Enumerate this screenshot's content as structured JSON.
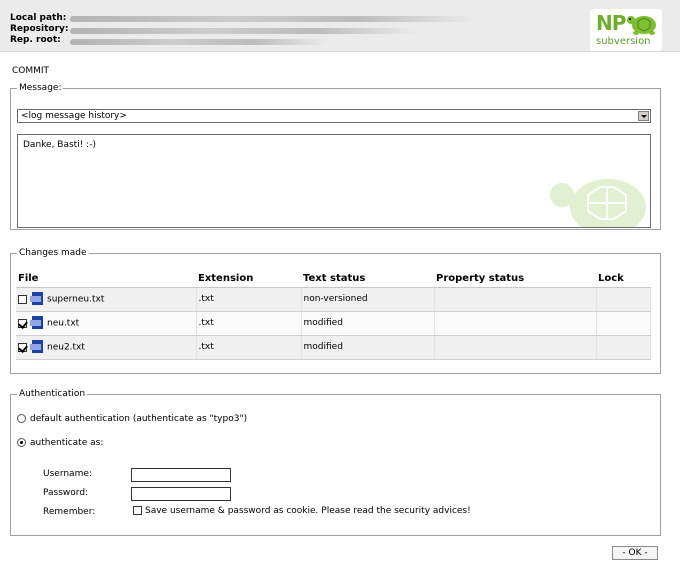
{
  "header": {
    "labels": [
      "Local path:",
      "Repository:",
      "Rep. root:"
    ],
    "logo": {
      "np": "NP",
      "sub": "subversion"
    }
  },
  "commit": {
    "title": "COMMIT",
    "message_legend": "Message:",
    "history_select": "<log message history>",
    "message_text": "Danke, Basti! :-)"
  },
  "changes": {
    "legend": "Changes made",
    "columns": [
      "File",
      "Extension",
      "Text status",
      "Property status",
      "Lock"
    ],
    "rows": [
      {
        "checked": false,
        "file": "superneu.txt",
        "ext": ".txt",
        "text_status": "non-versioned",
        "prop_status": "",
        "lock": ""
      },
      {
        "checked": true,
        "file": "neu.txt",
        "ext": ".txt",
        "text_status": "modified",
        "prop_status": "",
        "lock": ""
      },
      {
        "checked": true,
        "file": "neu2.txt",
        "ext": ".txt",
        "text_status": "modified",
        "prop_status": "",
        "lock": ""
      }
    ]
  },
  "auth": {
    "legend": "Authentication",
    "option_default": "default authentication (authenticate as \"typo3\")",
    "option_as": "authenticate as:",
    "selected": "authenticate as:",
    "username_label": "Username:",
    "password_label": "Password:",
    "remember_label": "Remember:",
    "username_value": "",
    "password_value": "",
    "remember_text": "Save username & password as cookie. Please read the security advices!"
  },
  "ok_button": "- OK -",
  "colors": {
    "logo_green": "#6fae2a",
    "header_bg": "#ebebeb",
    "border": "#a0a0a0"
  }
}
